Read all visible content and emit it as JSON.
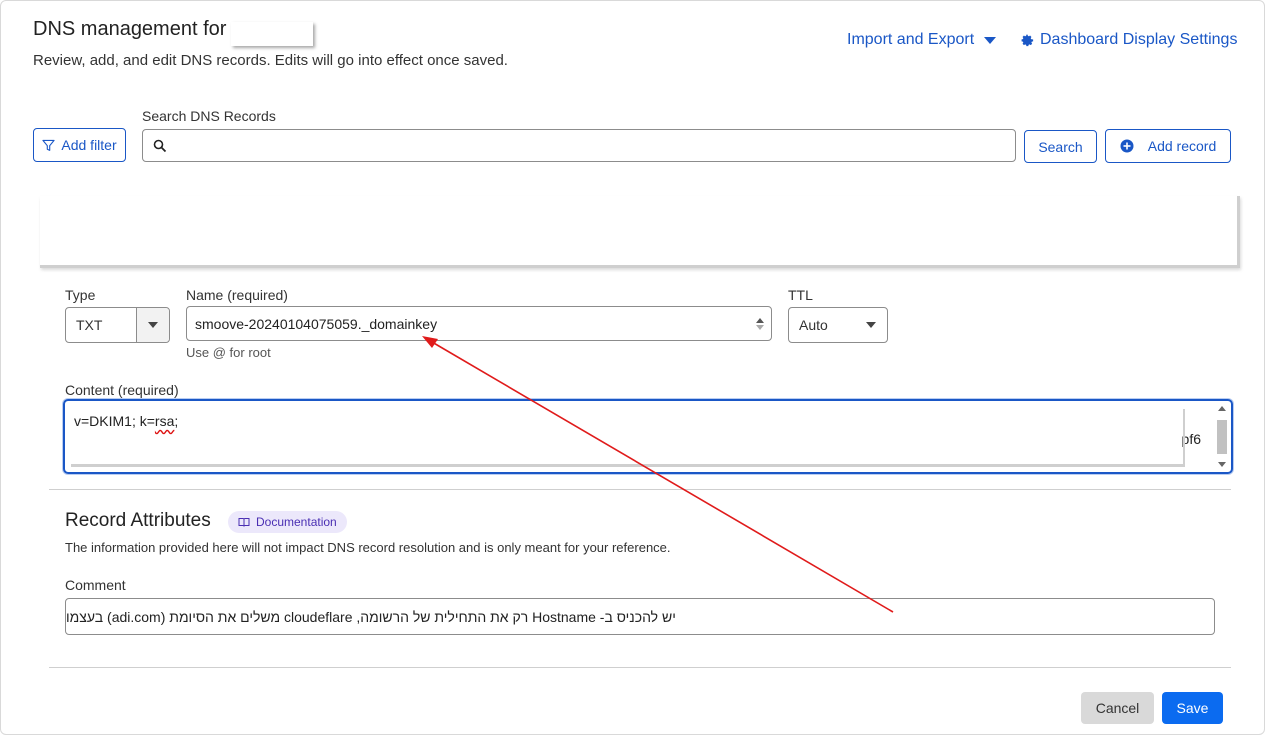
{
  "header": {
    "title": "DNS management for",
    "subtitle": "Review, add, and edit DNS records. Edits will go into effect once saved.",
    "import_export_label": "Import and Export",
    "dashboard_settings_label": "Dashboard Display Settings"
  },
  "toolbar": {
    "add_filter_label": "Add filter",
    "search_label": "Search DNS Records",
    "search_value": "",
    "search_button_label": "Search",
    "add_record_label": "Add record"
  },
  "record_form": {
    "type_label": "Type",
    "type_value": "TXT",
    "name_label": "Name (required)",
    "name_value": "smoove-20240104075059._domainkey",
    "name_hint": "Use @ for root",
    "ttl_label": "TTL",
    "ttl_value": "Auto",
    "content_label": "Content (required)",
    "content_prefix": "v=DKIM1; k=",
    "content_misspelled": "rsa",
    "content_suffix": ";",
    "content_tail": "pf6"
  },
  "attributes": {
    "title": "Record Attributes",
    "documentation_label": "Documentation",
    "description": "The information provided here will not impact DNS record resolution and is only meant for your reference.",
    "comment_label": "Comment",
    "comment_value": "יש להכניס ב- Hostname רק את התחילית של הרשומה, cloudeflare משלים את הסיומת (adi.com) בעצמו"
  },
  "actions": {
    "cancel_label": "Cancel",
    "save_label": "Save"
  },
  "colors": {
    "accent": "#1a57c6",
    "primary_button": "#0b6bf0",
    "annotation_arrow": "#e01b1b"
  }
}
